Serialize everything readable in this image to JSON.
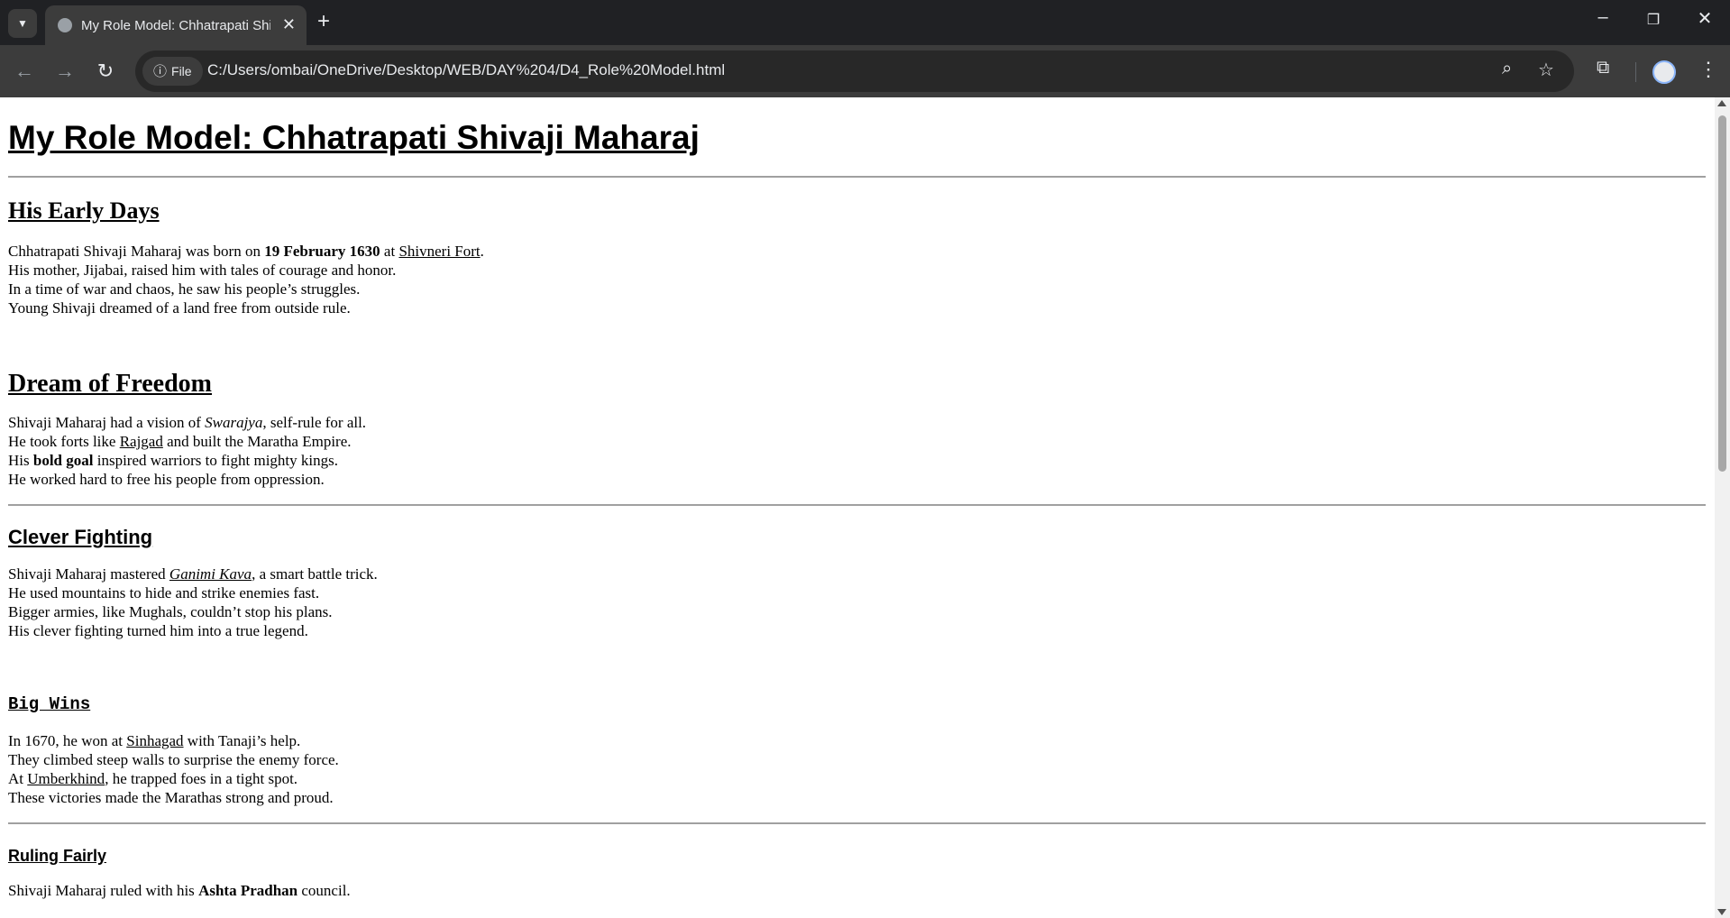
{
  "browser": {
    "tab_title": "My Role Model: Chhatrapati Shivaji Maharaj",
    "address_chip": "File",
    "url": "C:/Users/ombai/OneDrive/Desktop/WEB/DAY%204/D4_Role%20Model.html"
  },
  "page": {
    "title": "My Role Model: Chhatrapati Shivaji Maharaj",
    "early_days": {
      "heading": "His Early Days",
      "l1_a": "Chhatrapati Shivaji Maharaj was born on ",
      "l1_bold": "19 February 1630",
      "l1_b": " at ",
      "l1_link": "Shivneri Fort",
      "l1_c": ".",
      "l2": "His mother, Jijabai, raised him with tales of courage and honor.",
      "l3": "In a time of war and chaos, he saw his people’s struggles.",
      "l4": "Young Shivaji dreamed of a land free from outside rule."
    },
    "freedom": {
      "heading": "Dream of Freedom",
      "l1_a": "Shivaji Maharaj had a vision of ",
      "l1_italic": "Swarajya",
      "l1_b": ", self-rule for all.",
      "l2_a": "He took forts like ",
      "l2_link": "Rajgad",
      "l2_b": " and built the Maratha Empire.",
      "l3_a": "His ",
      "l3_bold": "bold goal",
      "l3_b": " inspired warriors to fight mighty kings.",
      "l4": "He worked hard to free his people from oppression."
    },
    "fighting": {
      "heading": "Clever Fighting",
      "l1_a": "Shivaji Maharaj mastered ",
      "l1_link": "Ganimi Kava",
      "l1_b": ", a smart battle trick.",
      "l2": "He used mountains to hide and strike enemies fast.",
      "l3": "Bigger armies, like Mughals, couldn’t stop his plans.",
      "l4": "His clever fighting turned him into a true legend."
    },
    "wins": {
      "heading": "Big Wins",
      "l1_a": "In 1670, he won at ",
      "l1_link": "Sinhagad",
      "l1_b": " with Tanaji’s help.",
      "l2": "They climbed steep walls to surprise the enemy force.",
      "l3_a": "At ",
      "l3_link": "Umberkhind",
      "l3_b": ", he trapped foes in a tight spot.",
      "l4": "These victories made the Marathas strong and proud."
    },
    "ruling": {
      "heading": "Ruling Fairly",
      "l1_a": "Shivaji Maharaj ruled with his ",
      "l1_bold": "Ashta Pradhan",
      "l1_b": " council."
    }
  }
}
